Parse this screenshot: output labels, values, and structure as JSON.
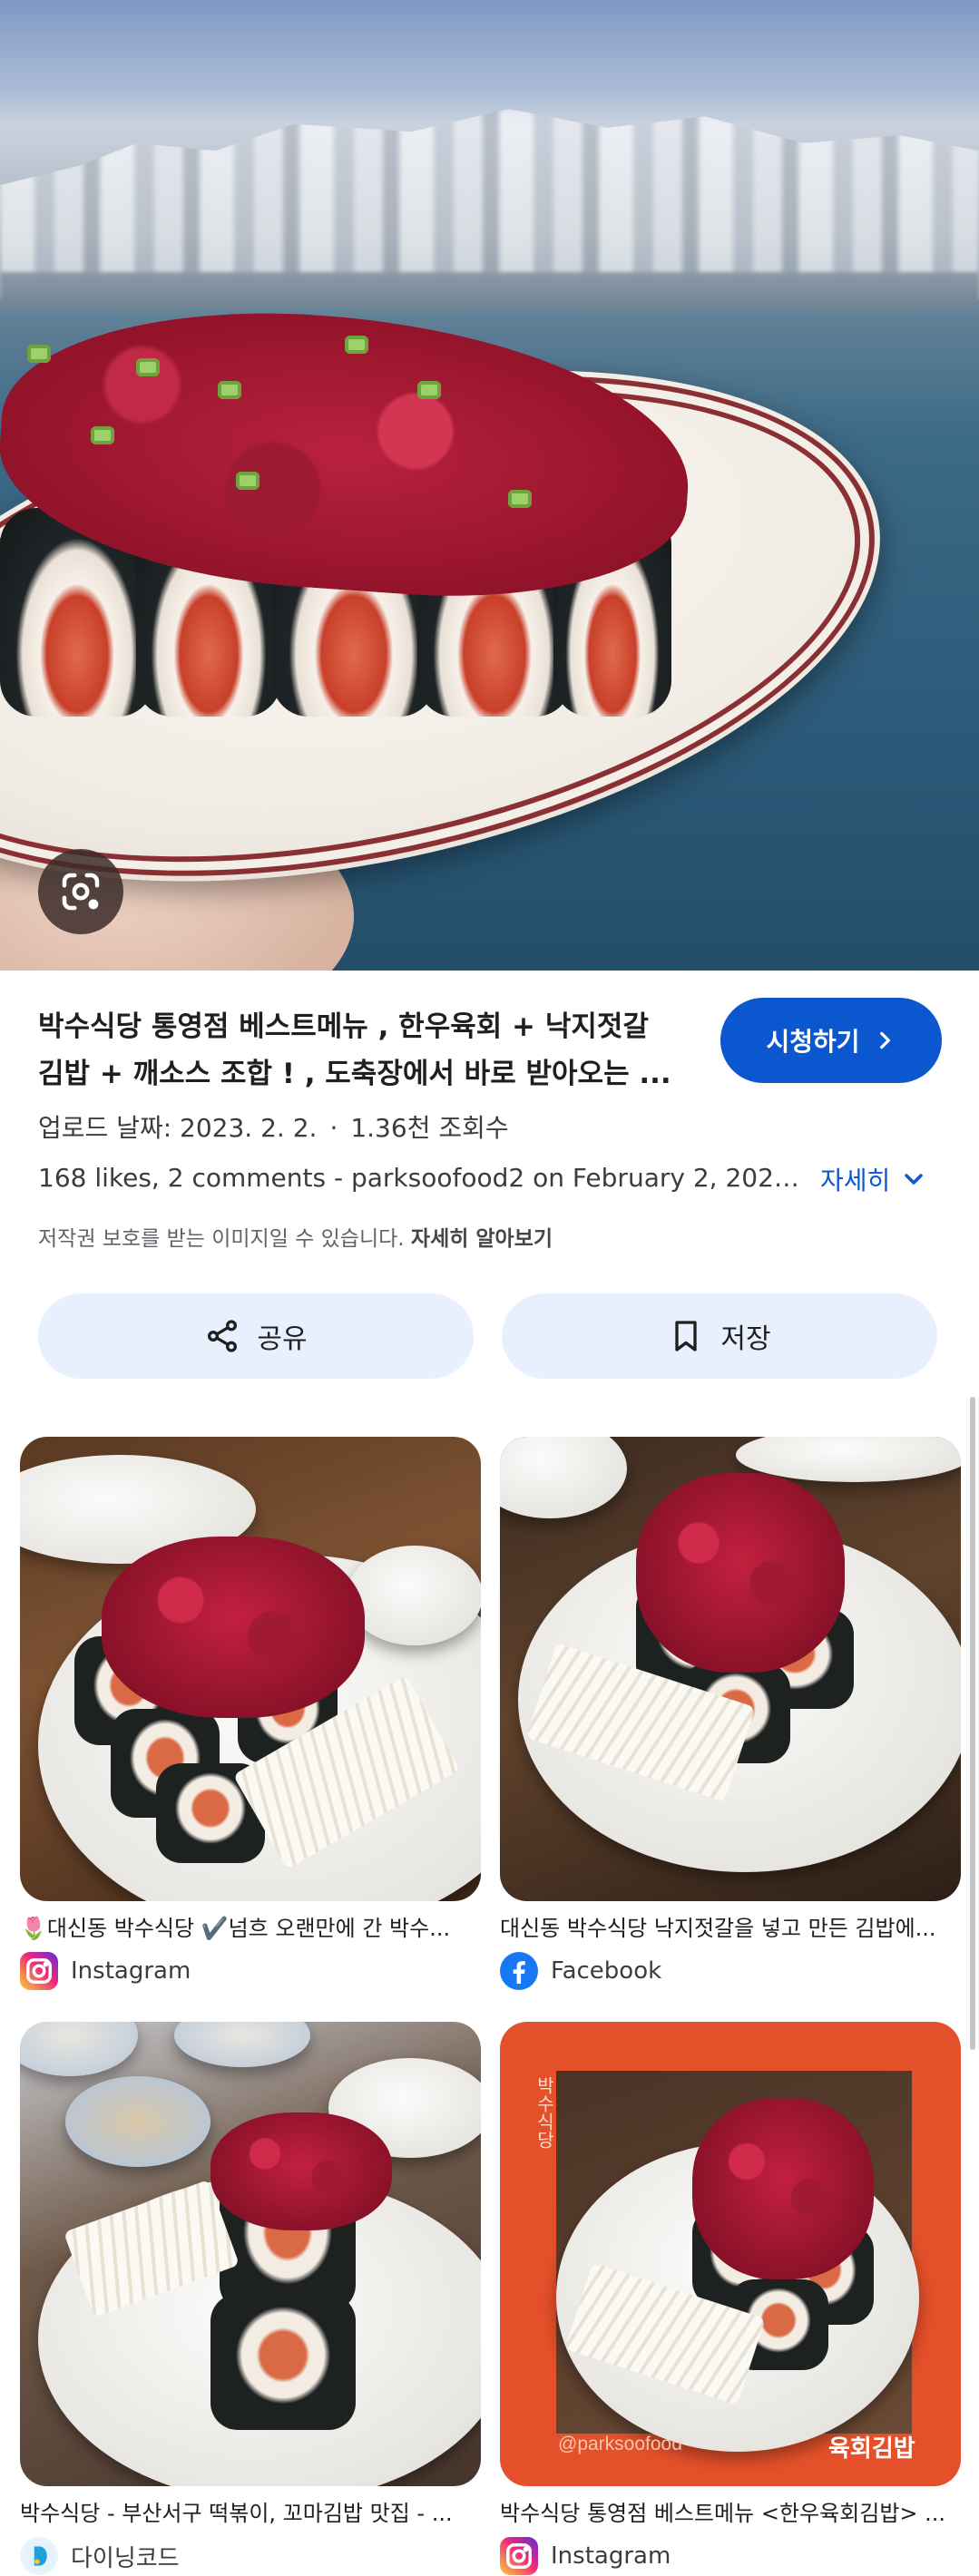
{
  "hero": {
    "image_alt": "hero image",
    "lens_button_icon": "google-lens-icon"
  },
  "result": {
    "title": "박수식당 통영점 베스트메뉴 , 한우육회 + 낙지젓갈 김밥 + 깨소스 조합 ! , 도축장에서 바로 받아오는 ...",
    "watch_label": "시청하기",
    "upload_label": "업로드 날짜: 2023. 2. 2.",
    "separator": "·",
    "views": "1.36천 조회수",
    "description": "168 likes, 2 comments - parksoofood2 on February 2, 2023:...",
    "more_label": "자세히",
    "copyright_text": "저작권 보호를 받는 이미지일 수 있습니다.",
    "copyright_link": "자세히 알아보기",
    "share_label": "공유",
    "save_label": "저장"
  },
  "related": [
    {
      "caption": "🌷대신동 박수식당 ✔️넘흐 오랜만에 간 박수...",
      "source": "Instagram",
      "source_icon": "instagram-icon"
    },
    {
      "caption": "대신동 박수식당 낙지젓갈을 넣고 만든 김밥에...",
      "source": "Facebook",
      "source_icon": "facebook-icon"
    },
    {
      "caption": "박수식당 - 부산서구 떡볶이, 꼬마김밥 맛집 - ...",
      "source": "다이닝코드",
      "source_icon": "diningcode-icon"
    },
    {
      "caption": "박수식당 통영점 베스트메뉴 <한우육회김밥> ...",
      "source": "Instagram",
      "source_icon": "instagram-icon"
    }
  ],
  "frame_card": {
    "vertical_text": "박수식당",
    "handle": "@parksoofood",
    "dish": "육회김밥"
  },
  "colors": {
    "accent": "#0b57d0",
    "tonal_button": "#e8f0fe",
    "frame_orange": "#e3502a"
  }
}
